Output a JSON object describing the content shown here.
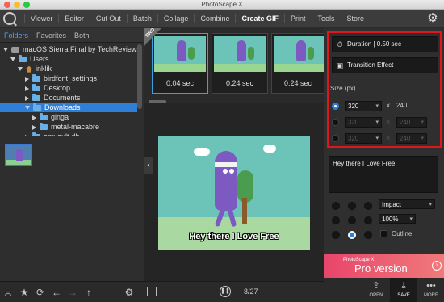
{
  "window": {
    "title": "PhotoScape X"
  },
  "menu": {
    "items": [
      "Viewer",
      "Editor",
      "Cut Out",
      "Batch",
      "Collage",
      "Combine",
      "Create GIF",
      "Print",
      "Tools",
      "Store"
    ],
    "active": "Create GIF"
  },
  "folders": {
    "tabs": [
      "Folders",
      "Favorites",
      "Both"
    ],
    "active_tab": "Folders",
    "tree": [
      {
        "label": "macOS Sierra Final by TechReviews",
        "icon": "drive-icon",
        "expanded": true
      },
      {
        "label": "Users",
        "icon": "folder-icon",
        "expanded": true
      },
      {
        "label": "inklik",
        "icon": "home-icon",
        "expanded": true
      },
      {
        "label": "birdfont_settings",
        "icon": "folder-icon",
        "expanded": false
      },
      {
        "label": "Desktop",
        "icon": "folder-icon",
        "expanded": false
      },
      {
        "label": "Documents",
        "icon": "folder-icon",
        "expanded": false
      },
      {
        "label": "Downloads",
        "icon": "folder-icon",
        "expanded": true,
        "selected": true
      },
      {
        "label": "ginga",
        "icon": "folder-icon",
        "expanded": false
      },
      {
        "label": "metal-macabre",
        "icon": "folder-icon",
        "expanded": false
      },
      {
        "label": "omyault-db",
        "icon": "folder-icon",
        "expanded": false
      }
    ]
  },
  "frames": {
    "pro_badge": "PRO",
    "items": [
      {
        "time": "0.04 sec",
        "selected": true
      },
      {
        "time": "0.24 sec",
        "selected": false
      },
      {
        "time": "0.24 sec",
        "selected": false
      }
    ]
  },
  "preview": {
    "caption": "Hey there I Love Free"
  },
  "playback": {
    "counter": "8/27"
  },
  "gif_settings": {
    "duration_label": "Duration | 0.50 sec",
    "transition_label": "Transition Effect",
    "size_label": "Size (px)",
    "sizes": [
      {
        "width": "320",
        "height": "240",
        "selected": true,
        "enabled": true
      },
      {
        "width": "320",
        "height": "240",
        "selected": false,
        "enabled": false
      },
      {
        "width": "320",
        "height": "240",
        "selected": false,
        "enabled": false
      }
    ],
    "times_sign": "x"
  },
  "text_options": {
    "text": "Hey there I Love Free",
    "font": "Impact",
    "zoom": "100%",
    "outline_label": "Outline",
    "outline_checked": false,
    "position_selected": 7
  },
  "promo": {
    "small": "PhotoScape X",
    "big": "Pro version"
  },
  "actions": {
    "open": "OPEN",
    "save": "SAVE",
    "more": "MORE"
  },
  "colors": {
    "accent": "#2f7fd9",
    "highlight_border": "#e0161c",
    "pro_banner": "#e8456b"
  }
}
